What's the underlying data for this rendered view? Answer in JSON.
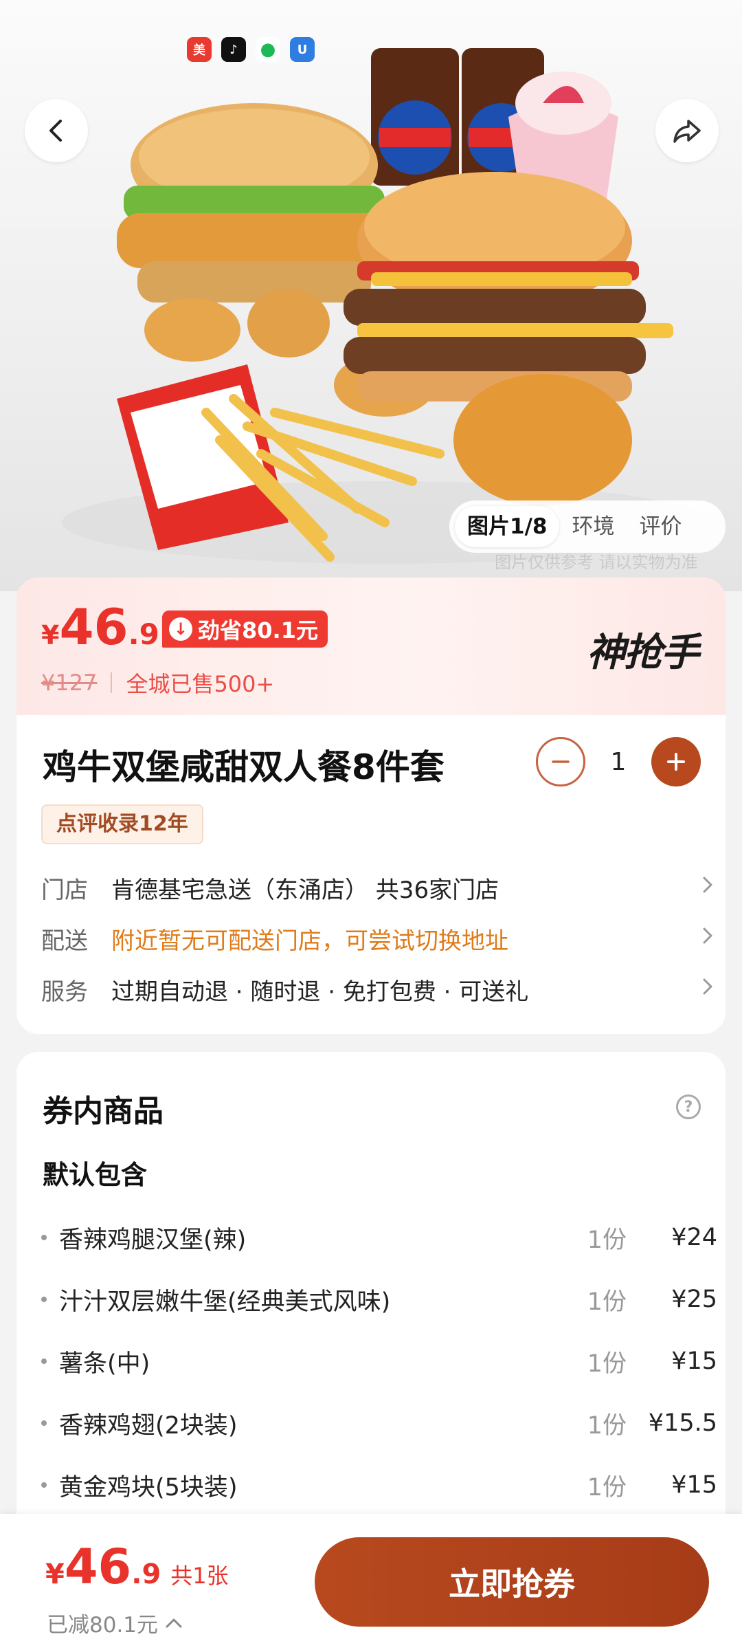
{
  "status_apps": [
    {
      "name": "meituan-app-icon",
      "glyph": "美",
      "class": "app-red"
    },
    {
      "name": "tiktok-app-icon",
      "glyph": "♪",
      "class": "app-black"
    },
    {
      "name": "spotify-app-icon",
      "glyph": "●",
      "class": "app-green"
    },
    {
      "name": "shield-app-icon",
      "glyph": "U",
      "class": "app-blue"
    }
  ],
  "gallery": {
    "tabs": [
      {
        "label": "图片1/8",
        "active": true
      },
      {
        "label": "环境",
        "active": false
      },
      {
        "label": "评价",
        "active": false
      }
    ],
    "note": "图片仅供参考 请以实物为准"
  },
  "price": {
    "yen": "¥",
    "integer": "46",
    "decimal": ".9",
    "save_badge": "劲省80.1元",
    "original": "¥127",
    "sold": "全城已售500+",
    "brand": "神抢手"
  },
  "product": {
    "title": "鸡牛双堡咸甜双人餐8件套",
    "quantity": "1",
    "tag": "点评收录12年"
  },
  "info": {
    "store_label": "门店",
    "store_value": "肯德基宅急送（东涌店） 共36家门店",
    "delivery_label": "配送",
    "delivery_value": "附近暂无可配送门店，可尝试切换地址",
    "service_label": "服务",
    "service_value": "过期自动退 · 随时退 · 免打包费 · 可送礼"
  },
  "contents": {
    "title": "券内商品",
    "subtitle": "默认包含",
    "items": [
      {
        "name": "香辣鸡腿汉堡(辣)",
        "qty": "1份",
        "price": "¥24"
      },
      {
        "name": "汁汁双层嫩牛堡(经典美式风味)",
        "qty": "1份",
        "price": "¥25"
      },
      {
        "name": "薯条(中)",
        "qty": "1份",
        "price": "¥15"
      },
      {
        "name": "香辣鸡翅(2块装)",
        "qty": "1份",
        "price": "¥15.5"
      },
      {
        "name": "黄金鸡块(5块装)",
        "qty": "1份",
        "price": "¥15"
      }
    ]
  },
  "bottom": {
    "yen": "¥",
    "integer": "46",
    "decimal": ".9",
    "count": "共1张",
    "saved": "已减80.1元",
    "buy_label": "立即抢券"
  },
  "colors": {
    "accent_red": "#e8322a",
    "brand_brown": "#b8491f",
    "warning_orange": "#e07b1a"
  }
}
